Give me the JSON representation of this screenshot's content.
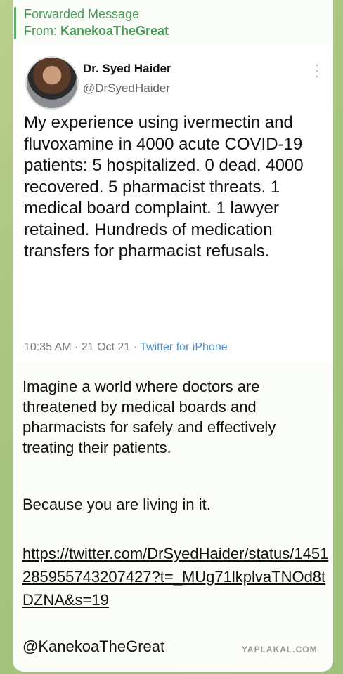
{
  "forward": {
    "label": "Forwarded Message",
    "from_prefix": "From: ",
    "from_name": "KanekoaTheGreat"
  },
  "tweet": {
    "author_name": "Dr. Syed Haider",
    "author_handle": "@DrSyedHaider",
    "text": "My experience using ivermectin and fluvoxamine in 4000 acute COVID-19 patients: 5 hospitalized. 0 dead. 4000 recovered. 5 pharmacist threats. 1 medical board complaint. 1 lawyer retained. Hundreds of medication transfers for pharmacist refusals.",
    "time": "10:35 AM · 21 Oct 21 · ",
    "source": "Twitter for iPhone",
    "avatar_icon": "profile-photo"
  },
  "message": {
    "paragraph1": "Imagine a world where doctors are threatened by medical boards and pharmacists for safely and effectively treating their patients.",
    "paragraph2": "Because you are living in it.",
    "link": "https://twitter.com/DrSyedHaider/status/1451285955743207427?t=_MUg71lkplvaTNOd8tDZNA&s=19",
    "signature": "@KanekoaTheGreat"
  },
  "watermark": "YAPLAKAL.COM",
  "colors": {
    "forward_green": "#4a9a55",
    "twitter_blue": "#4a90d0",
    "background": "#a8c47e"
  }
}
